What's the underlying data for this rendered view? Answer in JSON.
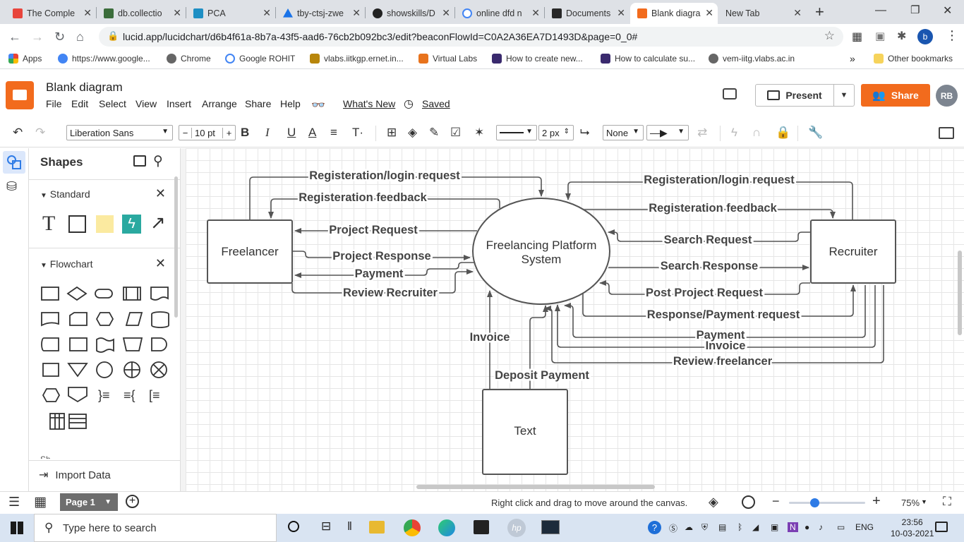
{
  "browser": {
    "tabs": [
      {
        "title": "The Comple",
        "color": "#e8453c"
      },
      {
        "title": "db.collectio",
        "color": "#3b6d3b"
      },
      {
        "title": "PCA",
        "color": "#1e8fc4"
      },
      {
        "title": "tby-ctsj-zwe",
        "color": "#1a73e8"
      },
      {
        "title": "showskills/D",
        "color": "#222222"
      },
      {
        "title": "online dfd n",
        "color": "#4285f4"
      },
      {
        "title": "Documents",
        "color": "#282828"
      },
      {
        "title": "Blank diagra",
        "color": "#f26b1d"
      },
      {
        "title": "New Tab",
        "color": "#ffffff"
      }
    ],
    "url": "lucid.app/lucidchart/d6b4f61a-8b7a-43f5-aad6-76cb2b092bc3/edit?beaconFlowId=C0A2A36EA7D1493D&page=0_0#",
    "profile_initial": "b",
    "bookmarks": [
      "Apps",
      "https://www.google...",
      "Chrome",
      "Google  ROHIT",
      "vlabs.iitkgp.ernet.in...",
      "Virtual Labs",
      "How to create new...",
      "How to calculate su...",
      "vem-iitg.vlabs.ac.in"
    ],
    "other_bookmarks": "Other bookmarks"
  },
  "app": {
    "doc_title": "Blank diagram",
    "menus": [
      "File",
      "Edit",
      "Select",
      "View",
      "Insert",
      "Arrange",
      "Share",
      "Help"
    ],
    "whats_new": "What's New",
    "saved": "Saved",
    "present_label": "Present",
    "share_label": "Share",
    "avatar_initials": "RB",
    "brand_color": "#f26b1d"
  },
  "toolbar": {
    "font": "Liberation Sans",
    "font_size": "10 pt",
    "line_width": "2 px",
    "arrow_start": "None"
  },
  "shapes_panel": {
    "title": "Shapes",
    "standard": "Standard",
    "flowchart": "Flowchart",
    "import_data": "Import Data"
  },
  "diagram": {
    "nodes": {
      "freelancer": "Freelancer",
      "system": [
        "Freelancing Platform",
        "System"
      ],
      "recruiter": "Recruiter",
      "text": "Text"
    },
    "labels": {
      "f_reg_req": "Registeration/login request",
      "f_reg_fb": "Registeration feedback",
      "f_proj_req": "Project Request",
      "f_proj_resp": "Project Response",
      "f_payment": "Payment",
      "f_review": "Review Recruiter",
      "r_reg_req": "Registeration/login request",
      "r_reg_fb": "Registeration feedback",
      "r_search_req": "Search Request",
      "r_search_resp": "Search Response",
      "r_post": "Post Project Request",
      "r_resp_pay": "Response/Payment request",
      "r_payment": "Payment",
      "r_invoice": "Invoice",
      "r_review": "Review freelancer",
      "invoice": "Invoice",
      "deposit": "Deposit Payment"
    }
  },
  "bottom": {
    "page": "Page 1",
    "hint": "Right click and drag to move around the canvas.",
    "zoom": "75%"
  },
  "taskbar": {
    "search_placeholder": "Type here to search",
    "lang": "ENG",
    "time": "23:56",
    "date": "10-03-2021"
  }
}
